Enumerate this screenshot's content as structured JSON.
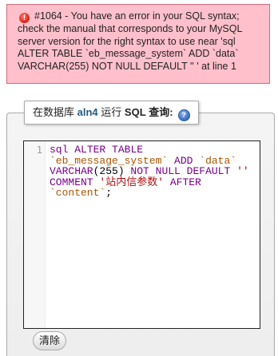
{
  "error": {
    "icon": "error-icon",
    "message": "#1064 - You have an error in your SQL syntax; check the manual that corresponds to your MySQL server version for the right syntax to use near 'sql ALTER TABLE `eb_message_system` ADD `data` VARCHAR(255) NOT NULL DEFAULT '' ' at line 1"
  },
  "query_panel": {
    "legend_prefix": "在数据库",
    "database": "aln4",
    "legend_middle": "运行",
    "legend_sql": "SQL",
    "legend_suffix": "查询:",
    "help_icon": "help-icon",
    "editor": {
      "line_number": "1",
      "tokens": {
        "t1": "sql",
        "t2": " ",
        "t3": "ALTER",
        "t4": " ",
        "t5": "TABLE",
        "t6": "`eb_message_system`",
        "t7": " ",
        "t8": "ADD",
        "t9": " ",
        "t10": "`data`",
        "t11": "VARCHAR",
        "t12": "(255) ",
        "t13": "NOT",
        "t14": " ",
        "t15": "NULL",
        "t16": " ",
        "t17": "DEFAULT",
        "t18": " ",
        "t19": "''",
        "t20": "COMMENT",
        "t21": " ",
        "t22": "'站内信参数'",
        "t23": " ",
        "t24": "AFTER",
        "t25": "`content`",
        "t26": ";"
      }
    },
    "clear_button": "清除"
  }
}
